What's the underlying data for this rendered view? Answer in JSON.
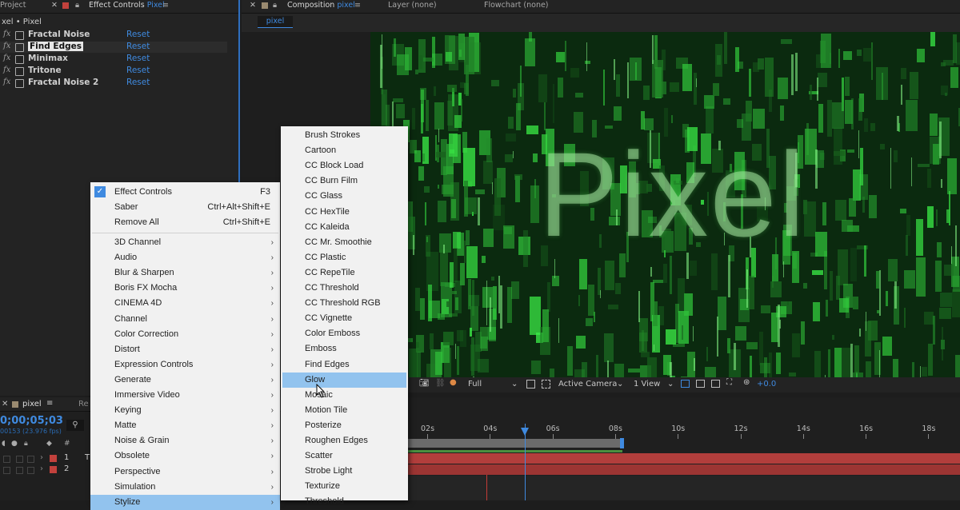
{
  "colors": {
    "accent": "#3f8ae0",
    "menu_highlight": "#92c3ee",
    "layer_bar": "#b23e3c",
    "matrix_green": "#2ecc40"
  },
  "left_tabs": {
    "project": "Project",
    "effect_controls": "Effect Controls",
    "effect_controls_target": "Pixel"
  },
  "effect_controls": {
    "breadcrumb": "xel • Pixel",
    "reset_label": "Reset",
    "effects": [
      "Fractal Noise",
      "Find Edges",
      "Minimax",
      "Tritone",
      "Fractal Noise 2"
    ]
  },
  "comp_tabs": {
    "composition": "Composition",
    "composition_name": "pixel",
    "layer": "Layer (none)",
    "flowchart": "Flowchart (none)",
    "subtab": "pixel"
  },
  "viewer": {
    "text": "Pixel"
  },
  "viewer_bar": {
    "resolution": "Full",
    "camera": "Active Camera",
    "views": "1 View",
    "exposure": "+0.0"
  },
  "context_menu": {
    "top_items": [
      {
        "label": "Effect Controls",
        "shortcut": "F3",
        "checked": true
      },
      {
        "label": "Saber",
        "shortcut": "Ctrl+Alt+Shift+E"
      },
      {
        "label": "Remove All",
        "shortcut": "Ctrl+Shift+E"
      }
    ],
    "categories": [
      "3D Channel",
      "Audio",
      "Blur & Sharpen",
      "Boris FX Mocha",
      "CINEMA 4D",
      "Channel",
      "Color Correction",
      "Distort",
      "Expression Controls",
      "Generate",
      "Immersive Video",
      "Keying",
      "Matte",
      "Noise & Grain",
      "Obsolete",
      "Perspective",
      "Simulation",
      "Stylize"
    ]
  },
  "submenu": {
    "items": [
      "Brush Strokes",
      "Cartoon",
      "CC Block Load",
      "CC Burn Film",
      "CC Glass",
      "CC HexTile",
      "CC Kaleida",
      "CC Mr. Smoothie",
      "CC Plastic",
      "CC RepeTile",
      "CC Threshold",
      "CC Threshold RGB",
      "CC Vignette",
      "Color Emboss",
      "Emboss",
      "Find Edges",
      "Glow",
      "Mosaic",
      "Motion Tile",
      "Posterize",
      "Roughen Edges",
      "Scatter",
      "Strobe Light",
      "Texturize",
      "Threshold"
    ],
    "highlighted": "Glow"
  },
  "timeline": {
    "tab": "pixel",
    "timecode": "0;00;05;03",
    "frame_info": "00153 (23.976 fps)",
    "ruler": [
      "02s",
      "04s",
      "06s",
      "08s",
      "10s",
      "12s",
      "14s",
      "16s",
      "18s"
    ],
    "layers": [
      {
        "num": "1",
        "name": "T"
      },
      {
        "num": "2",
        "name": ""
      }
    ],
    "render_tab": "Re"
  }
}
